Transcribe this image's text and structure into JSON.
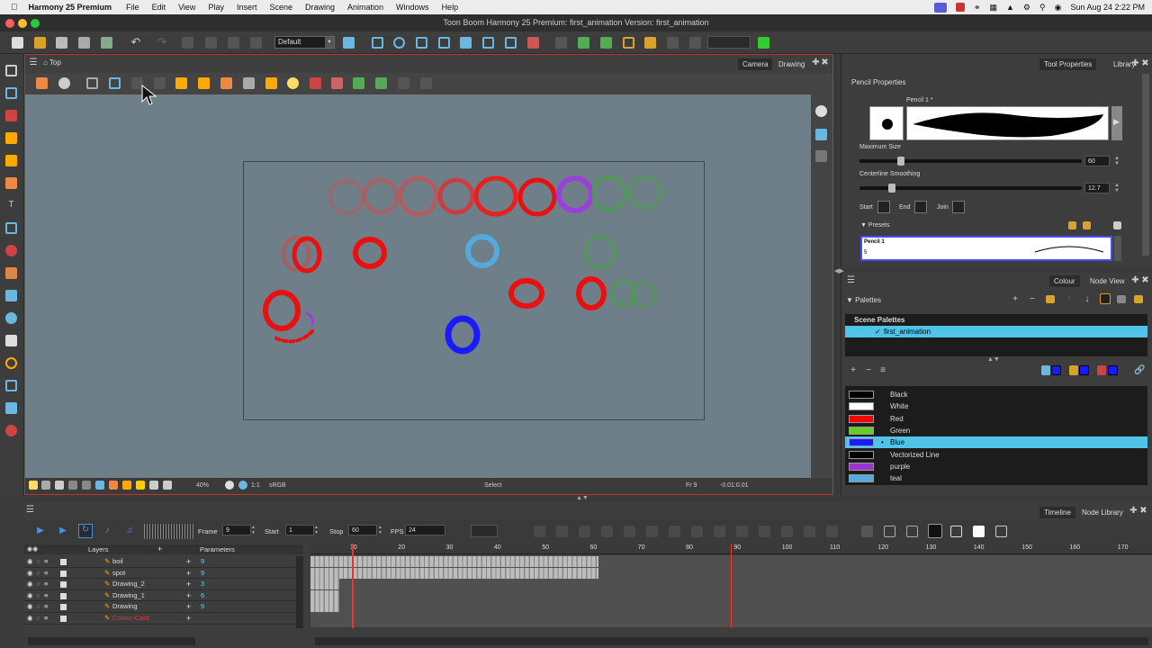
{
  "menubar": {
    "apple": "",
    "app_name": "Harmony 25 Premium",
    "items": [
      "File",
      "Edit",
      "View",
      "Play",
      "Insert",
      "Scene",
      "Drawing",
      "Animation",
      "Windows",
      "Help"
    ],
    "clock": "Sun Aug 24  2:22 PM"
  },
  "window": {
    "title": "Toon Boom Harmony 25 Premium: first_animation Version: first_animation"
  },
  "toolbar": {
    "workspace": "Default"
  },
  "camera_view": {
    "breadcrumb": "Top",
    "tabs": [
      "Camera",
      "Drawing"
    ],
    "zoom": "40%",
    "ratio": "1:1",
    "color_space": "sRGB",
    "tool": "Select",
    "frame": "Fr 9",
    "coords": "-0.01:0.01"
  },
  "tool_properties": {
    "tabs": [
      "Tool Properties",
      "Library"
    ],
    "title": "Pencil Properties",
    "preset_name": "Pencil 1 *",
    "max_size_label": "Maximum Size",
    "max_size": "60",
    "max_size_level": 0.17,
    "smoothing_label": "Centerline Smoothing",
    "smoothing": "12.7",
    "smoothing_level": 0.13,
    "start_label": "Start",
    "end_label": "End",
    "join_label": "Join",
    "presets_label": "Presets",
    "preset_item": "Pencil 1",
    "preset_item_size": "5"
  },
  "colour": {
    "tabs": [
      "Colour",
      "Node View"
    ],
    "palettes_label": "Palettes",
    "scene_palettes": "Scene Palettes",
    "palette": "first_animation",
    "swatches": [
      {
        "name": "Black",
        "color": "#000000"
      },
      {
        "name": "White",
        "color": "#ffffff"
      },
      {
        "name": "Red",
        "color": "#ff0000"
      },
      {
        "name": "Green",
        "color": "#66cc22"
      },
      {
        "name": "Blue",
        "color": "#1a1aff",
        "selected": true
      },
      {
        "name": "Vectorized Line",
        "color": "#000000"
      },
      {
        "name": "purple",
        "color": "#9933cc"
      },
      {
        "name": "teal",
        "color": "#55aadd"
      }
    ]
  },
  "timeline": {
    "tabs": [
      "Timeline",
      "Node Library"
    ],
    "frame_label": "Frame",
    "frame": "9",
    "start_label": "Start",
    "start": "1",
    "stop_label": "Stop",
    "stop": "60",
    "fps_label": "FPS",
    "fps": "24",
    "layers_header": "Layers",
    "params_header": "Parameters",
    "ruler": [
      "10",
      "20",
      "30",
      "40",
      "50",
      "60",
      "70",
      "80",
      "90",
      "100",
      "110",
      "120",
      "130",
      "140",
      "150",
      "160",
      "170"
    ],
    "layers": [
      {
        "name": "boil",
        "param": "9"
      },
      {
        "name": "spot",
        "param": "9"
      },
      {
        "name": "Drawing_2",
        "param": "3"
      },
      {
        "name": "Drawing_1",
        "param": "6"
      },
      {
        "name": "Drawing",
        "param": "9"
      },
      {
        "name": "Colour-Card",
        "param": ""
      }
    ]
  }
}
